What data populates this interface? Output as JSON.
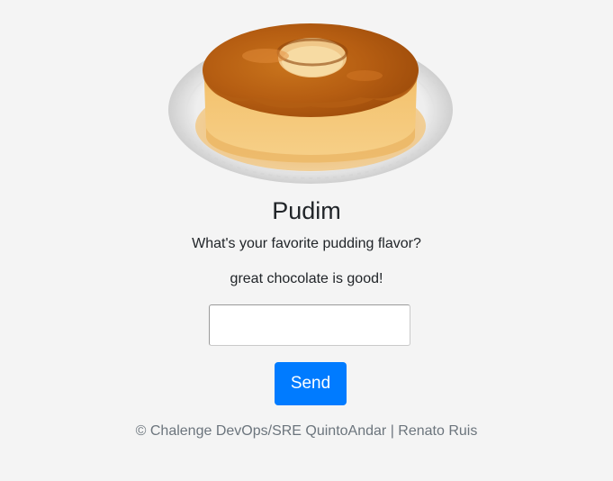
{
  "hero": {
    "image_name": "pudim-image"
  },
  "title": "Pudim",
  "question": "What's your favorite pudding flavor?",
  "answer": "great chocolate is good!",
  "form": {
    "input_value": "",
    "send_label": "Send"
  },
  "footer": "© Chalenge DevOps/SRE QuintoAndar | Renato Ruis",
  "colors": {
    "background": "#f4f4f4",
    "button": "#007bff",
    "footer_text": "#6c757d"
  }
}
